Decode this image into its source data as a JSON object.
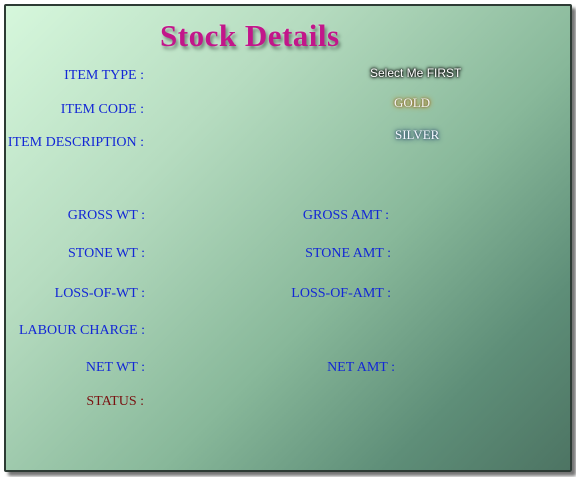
{
  "page": {
    "title": "Stock Details"
  },
  "labels": {
    "item_type": "ITEM TYPE :",
    "item_code": "ITEM CODE :",
    "item_description": "ITEM DESCRIPTION :",
    "gross_wt": "GROSS WT :",
    "gross_amt": "GROSS AMT :",
    "stone_wt": "STONE WT :",
    "stone_amt": "STONE AMT :",
    "loss_of_wt": "LOSS-OF-WT :",
    "loss_of_amt": "LOSS-OF-AMT :",
    "labour_charge": "LABOUR CHARGE :",
    "net_wt": "NET WT :",
    "net_amt": "NET AMT :",
    "status": "STATUS :"
  },
  "item_type_options": [
    "Select Me FIRST",
    "GOLD",
    "SILVER"
  ],
  "colors": {
    "label": "#1327d6",
    "status": "#7a1010",
    "title": "#c2168a",
    "panel_light": "#d6f7dc",
    "panel_dark": "#4d7463"
  }
}
